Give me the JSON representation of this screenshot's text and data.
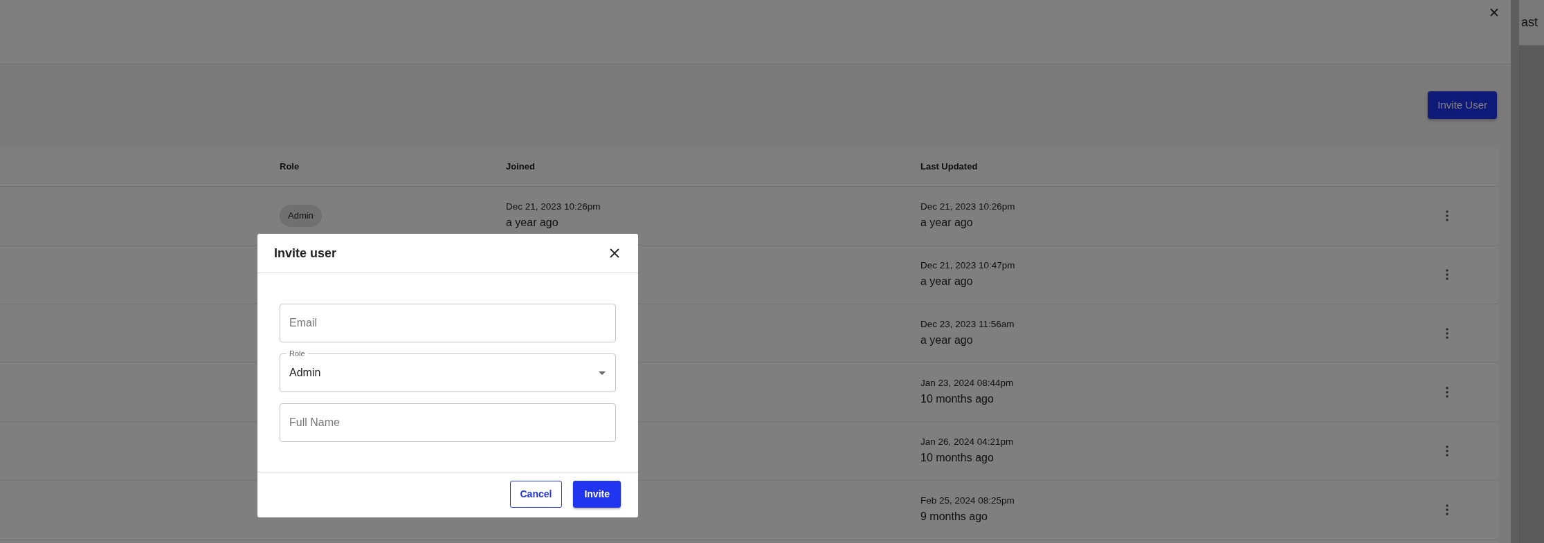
{
  "side_panel": {
    "label": "ast"
  },
  "invite_button": "Invite User",
  "table": {
    "columns": [
      "Role",
      "Joined",
      "Last Updated"
    ],
    "rows": [
      {
        "role": "Admin",
        "joined_date": "Dec 21, 2023 10:26pm",
        "joined_relative": "a year ago",
        "updated_date": "Dec 21, 2023 10:26pm",
        "updated_relative": "a year ago"
      },
      {
        "updated_date": "Dec 21, 2023 10:47pm",
        "updated_relative": "a year ago"
      },
      {
        "updated_date": "Dec 23, 2023 11:56am",
        "updated_relative": "a year ago"
      },
      {
        "updated_date": "Jan 23, 2024 08:44pm",
        "updated_relative": "10 months ago"
      },
      {
        "updated_date": "Jan 26, 2024 04:21pm",
        "updated_relative": "10 months ago"
      },
      {
        "updated_date": "Feb 25, 2024 08:25pm",
        "updated_relative": "9 months ago"
      }
    ]
  },
  "modal": {
    "title": "Invite user",
    "fields": [
      {
        "kind": "text",
        "placeholder": "Email"
      },
      {
        "kind": "select",
        "label": "Role",
        "value": "Admin"
      },
      {
        "kind": "text",
        "placeholder": "Full Name"
      }
    ],
    "buttons": [
      {
        "kind": "outline",
        "label": "Cancel"
      },
      {
        "kind": "primary",
        "label": "Invite"
      }
    ]
  }
}
